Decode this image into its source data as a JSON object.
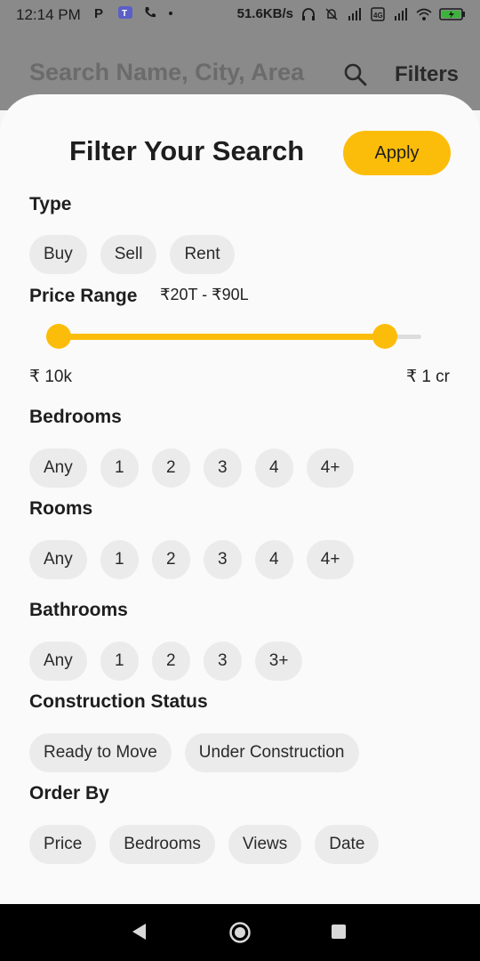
{
  "status_bar": {
    "time": "12:14 PM",
    "network_speed": "51.6KB/s",
    "icons": [
      "p-app-icon",
      "teams-icon",
      "phone-icon",
      "dot-icon",
      "headset-icon",
      "silent-icon",
      "signal-icon",
      "volte-icon",
      "signal-icon-2",
      "wifi-icon",
      "battery-icon"
    ]
  },
  "background_header": {
    "search_placeholder": "Search Name, City, Area",
    "filters_label": "Filters"
  },
  "sheet": {
    "title": "Filter Your Search",
    "apply_label": "Apply"
  },
  "type": {
    "label": "Type",
    "options": [
      "Buy",
      "Sell",
      "Rent"
    ]
  },
  "price": {
    "label": "Price Range",
    "value": "₹20T - ₹90L",
    "min_label": "₹ 10k",
    "max_label": "₹ 1 cr",
    "low_fraction": 0.0,
    "high_fraction": 0.9,
    "accent_color": "#fcbd0a"
  },
  "bedrooms": {
    "label": "Bedrooms",
    "options": [
      "Any",
      "1",
      "2",
      "3",
      "4",
      "4+"
    ]
  },
  "rooms": {
    "label": "Rooms",
    "options": [
      "Any",
      "1",
      "2",
      "3",
      "4",
      "4+"
    ]
  },
  "bathrooms": {
    "label": "Bathrooms",
    "options": [
      "Any",
      "1",
      "2",
      "3",
      "3+"
    ]
  },
  "construction": {
    "label": "Construction Status",
    "options": [
      "Ready to Move",
      "Under Construction"
    ]
  },
  "order_by": {
    "label": "Order By",
    "options": [
      "Price",
      "Bedrooms",
      "Views",
      "Date"
    ]
  },
  "nav": {
    "icons": [
      "back-icon",
      "home-icon",
      "recents-icon"
    ]
  }
}
